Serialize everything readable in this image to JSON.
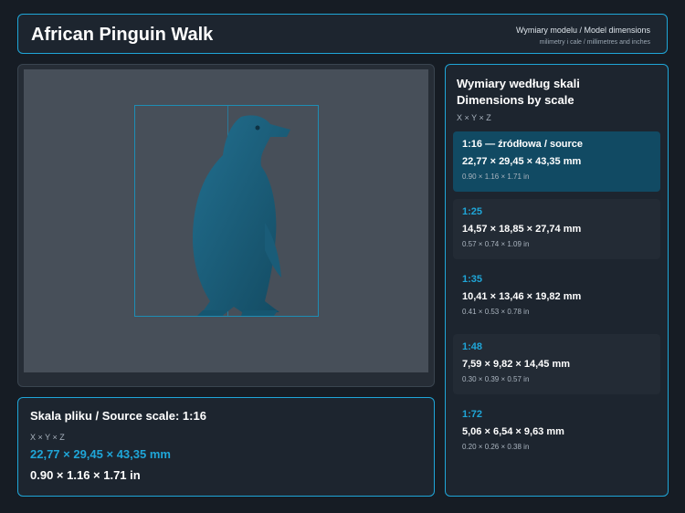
{
  "header": {
    "title": "African Pinguin Walk",
    "subtitle": "Wymiary modelu / Model dimensions",
    "subtitle2": "milimetry i cale / millimetres and inches"
  },
  "viewer": {
    "icon": "penguin-model"
  },
  "source": {
    "title": "Skala pliku / Source scale: 1:16",
    "axes": "X × Y × Z",
    "mm": "22,77 × 29,45 × 43,35 mm",
    "in": "0.90 × 1.16 × 1.71 in"
  },
  "scales": {
    "title_pl": "Wymiary według skali",
    "title_en": "Dimensions by scale",
    "axes": "X × Y × Z",
    "items": [
      {
        "label": "1:16  —  źródłowa / source",
        "mm": "22,77 × 29,45 × 43,35 mm",
        "in": "0.90 × 1.16 × 1.71 in"
      },
      {
        "label": "1:25",
        "mm": "14,57 × 18,85 × 27,74 mm",
        "in": "0.57 × 0.74 × 1.09 in"
      },
      {
        "label": "1:35",
        "mm": "10,41 × 13,46 × 19,82 mm",
        "in": "0.41 × 0.53 × 0.78 in"
      },
      {
        "label": "1:48",
        "mm": "7,59 × 9,82 × 14,45 mm",
        "in": "0.30 × 0.39 × 0.57 in"
      },
      {
        "label": "1:72",
        "mm": "5,06 × 6,54 × 9,63 mm",
        "in": "0.20 × 0.26 × 0.38 in"
      }
    ]
  },
  "colors": {
    "accent": "#1fa6d8",
    "background": "#161c24",
    "panel": "#1d252f",
    "active_card": "#114a63",
    "model": "#1b5f7a"
  }
}
